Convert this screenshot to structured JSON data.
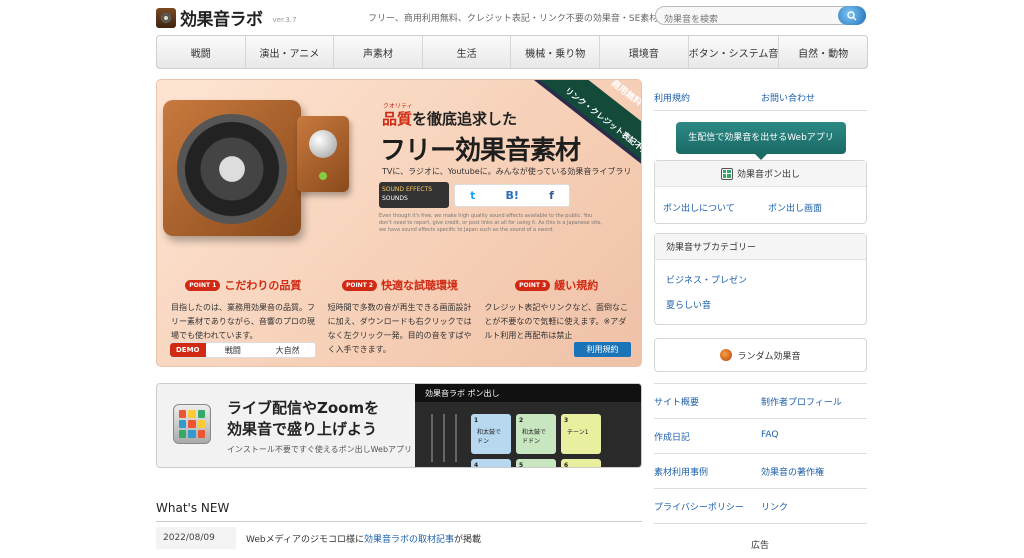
{
  "header": {
    "logo_text": "効果音ラボ",
    "version": "ver.3.7",
    "tagline": "フリー、商用利用無料、クレジット表記・リンク不要の効果音・SE素材をダウンロード",
    "search_placeholder": "効果音を検索"
  },
  "nav": {
    "items": [
      "戦闘",
      "演出・アニメ",
      "声素材",
      "生活",
      "機械・乗り物",
      "環境音",
      "ボタン・システム音",
      "自然・動物"
    ]
  },
  "hero": {
    "kicker_small": "クオリティ",
    "subtitle_accent": "品質",
    "subtitle_rest": "を徹底追求した",
    "title": "フリー効果音素材",
    "line": "TVに、ラジオに、Youtubeに。みんなが使っている効果音ライブラリ",
    "badge_title": "SOUND EFFECTS",
    "badge_text": "SOUNDS",
    "ribbon1": "商用無料",
    "ribbon2": "リンク・クレジット表記不要",
    "english": "Even though it's free, we make high quality sound effects available to the public. You don't need to report, give credit, or post links at all for using it. As this is a Japanese site, we have sound effects specific to Japan such as the sound of a sword.",
    "points": [
      {
        "badge": "POINT 1",
        "title": "こだわりの品質",
        "body": "目指したのは、業務用効果音の品質。フリー素材でありながら、音響のプロの現場でも使われています。"
      },
      {
        "badge": "POINT 2",
        "title": "快適な試聴環境",
        "body": "短時間で多数の音が再生できる画面設計に加え、ダウンロードも右クリックではなく左クリック一発。目的の音をすばやく入手できます。"
      },
      {
        "badge": "POINT 3",
        "title": "緩い規約",
        "body": "クレジット表記やリンクなど、面倒なことが不要なので気軽に使えます。※アダルト利用と再配布は禁止"
      }
    ],
    "demo_label": "DEMO",
    "demo_items": [
      "戦闘",
      "大自然"
    ],
    "rules_button": "利用規約"
  },
  "banner": {
    "title_line1": "ライブ配信やZoomを",
    "title_line2": "効果音で盛り上げよう",
    "subtitle": "インストール不要ですぐ使えるポン出しWebアプリ",
    "app_title": "効果音ラボ ポン出し",
    "pads": [
      {
        "num": "1",
        "label": "和太鼓でドン",
        "color": "#b8d8f0"
      },
      {
        "num": "2",
        "label": "和太鼓でドドン",
        "color": "#c8e6c0"
      },
      {
        "num": "3",
        "label": "チーン1",
        "color": "#e8f0a0"
      },
      {
        "num": "4",
        "label": "",
        "color": "#b8d8f0"
      },
      {
        "num": "5",
        "label": "",
        "color": "#c8e6c0"
      },
      {
        "num": "6",
        "label": "",
        "color": "#e8f0a0"
      }
    ]
  },
  "news": {
    "heading": "What's NEW",
    "items": [
      {
        "date": "2022/08/09",
        "prefix": "Webメディアのジモコロ様に",
        "link": "効果音ラボの取材記事",
        "suffix": "が掲載"
      }
    ]
  },
  "sidebar": {
    "top_links": [
      "利用規約",
      "お問い合わせ"
    ],
    "app_button": "生配信で効果音を出せるWebアプリ",
    "pon_title": "効果音ポン出し",
    "pon_links": [
      "ポン出しについて",
      "ポン出し画面"
    ],
    "sub_title": "効果音サブカテゴリー",
    "sub_items": [
      "ビジネス・プレゼン",
      "夏らしい音"
    ],
    "random_button": "ランダム効果音",
    "links": [
      [
        "サイト概要",
        "制作者プロフィール"
      ],
      [
        "作成日記",
        "FAQ"
      ],
      [
        "素材利用事例",
        "効果音の著作権"
      ],
      [
        "プライバシーポリシー",
        "リンク"
      ]
    ],
    "ad_label": "広告"
  },
  "colors": {
    "accent_red": "#d02a14",
    "link_blue": "#1b5fa8",
    "app_green": "#1a6a66"
  }
}
